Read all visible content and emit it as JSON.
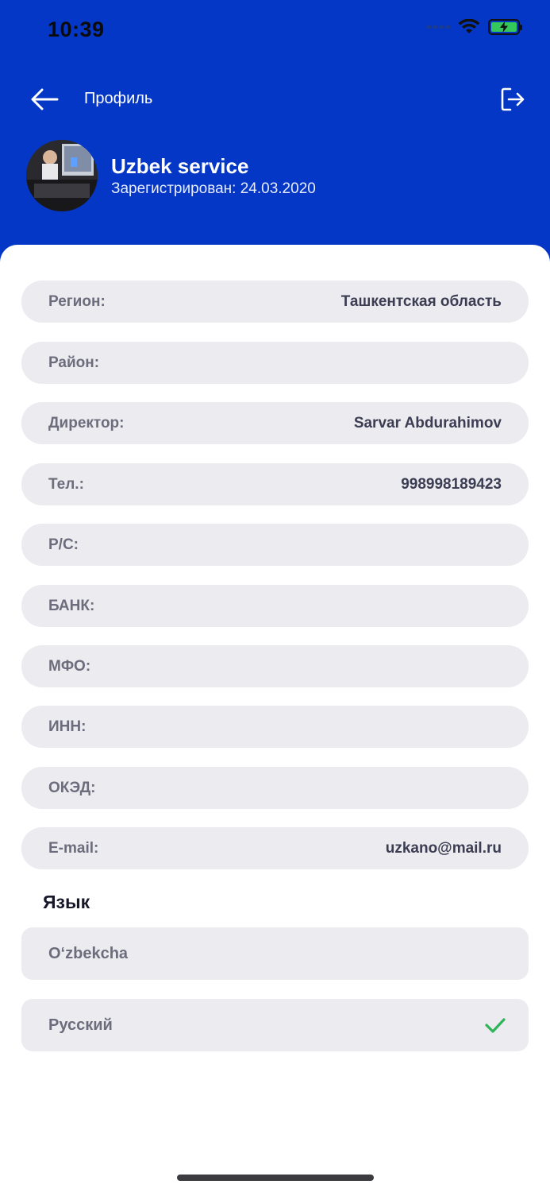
{
  "status_bar": {
    "time": "10:39"
  },
  "nav": {
    "title": "Профиль"
  },
  "profile": {
    "name": "Uzbek service",
    "registered": "Зарегистрирован: 24.03.2020"
  },
  "fields": [
    {
      "label": "Регион:",
      "value": "Ташкентская область"
    },
    {
      "label": "Район:",
      "value": ""
    },
    {
      "label": "Директор:",
      "value": "Sarvar Abdurahimov"
    },
    {
      "label": "Тел.:",
      "value": "998998189423"
    },
    {
      "label": "Р/С:",
      "value": ""
    },
    {
      "label": "БАНК:",
      "value": ""
    },
    {
      "label": "МФО:",
      "value": ""
    },
    {
      "label": "ИНН:",
      "value": ""
    },
    {
      "label": "ОКЭД:",
      "value": ""
    },
    {
      "label": "E-mail:",
      "value": "uzkano@mail.ru"
    }
  ],
  "language": {
    "heading": "Язык",
    "options": [
      {
        "label": "O‘zbekcha",
        "selected": false
      },
      {
        "label": "Русский",
        "selected": true
      }
    ]
  },
  "colors": {
    "brand_blue": "#0437c6",
    "field_bg": "#ebebf0",
    "check_green": "#2fb45a"
  }
}
